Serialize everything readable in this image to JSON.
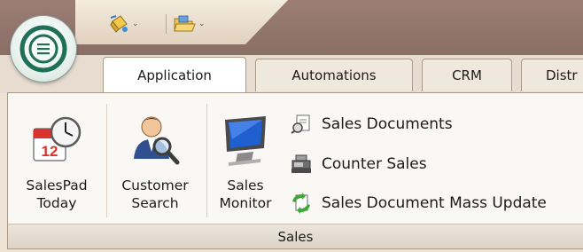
{
  "quick_access": {
    "items": [
      {
        "icon": "paint-bucket-icon"
      },
      {
        "icon": "folder-open-icon"
      }
    ]
  },
  "tabs": [
    "Application",
    "Automations",
    "CRM",
    "Distr"
  ],
  "ribbon": {
    "big_buttons": [
      {
        "line1": "SalesPad",
        "line2": "Today",
        "icon": "calendar-clock-icon"
      },
      {
        "line1": "Customer",
        "line2": "Search",
        "icon": "customer-search-icon"
      },
      {
        "line1": "Sales",
        "line2": "Monitor",
        "icon": "monitor-icon"
      }
    ],
    "small_buttons": [
      {
        "label": "Sales Documents",
        "icon": "sales-documents-icon"
      },
      {
        "label": "Counter Sales",
        "icon": "cash-register-icon"
      },
      {
        "label": "Sales Document Mass Update",
        "icon": "mass-update-icon"
      }
    ],
    "group_label": "Sales"
  }
}
